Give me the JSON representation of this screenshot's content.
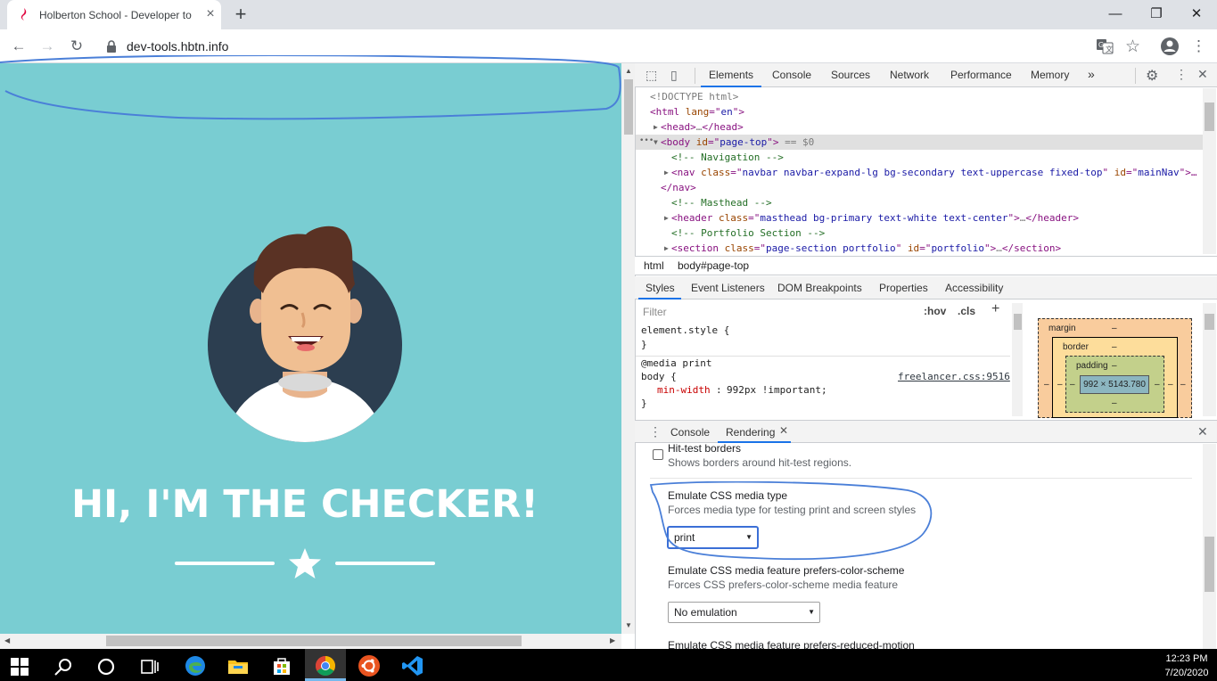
{
  "browser": {
    "tab_title": "Holberton School - Developer to",
    "url": "dev-tools.hbtn.info"
  },
  "page": {
    "hero_title": "HI, I'M THE CHECKER!"
  },
  "devtools": {
    "tabs": [
      "Elements",
      "Console",
      "Sources",
      "Network",
      "Performance",
      "Memory"
    ],
    "more_tabs": "»",
    "elements_lines": [
      {
        "parts": [
          {
            "c": "dim",
            "t": "<!DOCTYPE html>"
          }
        ]
      },
      {
        "parts": [
          {
            "c": "tag",
            "t": "<html "
          },
          {
            "c": "attr",
            "t": "lang"
          },
          {
            "c": "tag",
            "t": "=\""
          },
          {
            "c": "val",
            "t": "en"
          },
          {
            "c": "tag",
            "t": "\">"
          }
        ]
      },
      {
        "parts": [
          {
            "c": "tag",
            "t": "<head>"
          },
          {
            "c": "dim",
            "t": "…"
          },
          {
            "c": "tag",
            "t": "</head>"
          }
        ]
      },
      {
        "parts": [
          {
            "c": "tag",
            "t": "<body "
          },
          {
            "c": "attr",
            "t": "id"
          },
          {
            "c": "tag",
            "t": "=\""
          },
          {
            "c": "val",
            "t": "page-top"
          },
          {
            "c": "tag",
            "t": "\">"
          },
          {
            "c": "dim",
            "t": " == $0"
          }
        ]
      },
      {
        "parts": [
          {
            "c": "cmt",
            "t": "<!-- Navigation -->"
          }
        ]
      },
      {
        "parts": [
          {
            "c": "tag",
            "t": "<nav "
          },
          {
            "c": "attr",
            "t": "class"
          },
          {
            "c": "tag",
            "t": "=\""
          },
          {
            "c": "val",
            "t": "navbar navbar-expand-lg bg-secondary text-uppercase fixed-top"
          },
          {
            "c": "tag",
            "t": "\" "
          },
          {
            "c": "attr",
            "t": "id"
          },
          {
            "c": "tag",
            "t": "=\""
          },
          {
            "c": "val",
            "t": "mainNav"
          },
          {
            "c": "tag",
            "t": "\">…"
          }
        ]
      },
      {
        "parts": [
          {
            "c": "tag",
            "t": "</nav>"
          }
        ]
      },
      {
        "parts": [
          {
            "c": "cmt",
            "t": "<!-- Masthead -->"
          }
        ]
      },
      {
        "parts": [
          {
            "c": "tag",
            "t": "<header "
          },
          {
            "c": "attr",
            "t": "class"
          },
          {
            "c": "tag",
            "t": "=\""
          },
          {
            "c": "val",
            "t": "masthead bg-primary text-white text-center"
          },
          {
            "c": "tag",
            "t": "\">"
          },
          {
            "c": "dim",
            "t": "…"
          },
          {
            "c": "tag",
            "t": "</header>"
          }
        ]
      },
      {
        "parts": [
          {
            "c": "cmt",
            "t": "<!-- Portfolio Section -->"
          }
        ]
      },
      {
        "parts": [
          {
            "c": "tag",
            "t": "<section "
          },
          {
            "c": "attr",
            "t": "class"
          },
          {
            "c": "tag",
            "t": "=\""
          },
          {
            "c": "val",
            "t": "page-section portfolio"
          },
          {
            "c": "tag",
            "t": "\" "
          },
          {
            "c": "attr",
            "t": "id"
          },
          {
            "c": "tag",
            "t": "=\""
          },
          {
            "c": "val",
            "t": "portfolio"
          },
          {
            "c": "tag",
            "t": "\">"
          },
          {
            "c": "dim",
            "t": "…"
          },
          {
            "c": "tag",
            "t": "</section>"
          }
        ]
      }
    ],
    "breadcrumb": [
      "html",
      "body#page-top"
    ],
    "sub_tabs": [
      "Styles",
      "Event Listeners",
      "DOM Breakpoints",
      "Properties",
      "Accessibility"
    ],
    "filter_placeholder": "Filter",
    "hov": ":hov",
    "cls": ".cls",
    "plus": "+",
    "styles": {
      "element_style_open": "element.style {",
      "close_brace": "}",
      "media": "@media print",
      "selector": "body {",
      "property": "min-width",
      "value": "992px !important;",
      "source": "freelancer.css:9516"
    },
    "box_model": {
      "margin_label": "margin",
      "border_label": "border",
      "padding_label": "padding",
      "dash": "–",
      "content_size": "992 × 5143.780"
    },
    "drawer_tabs": [
      "Console",
      "Rendering"
    ],
    "rendering": {
      "hit_test_title": "Hit-test borders",
      "hit_test_desc": "Shows borders around hit-test regions.",
      "media_type_title": "Emulate CSS media type",
      "media_type_desc": "Forces media type for testing print and screen styles",
      "media_type_value": "print",
      "color_scheme_title": "Emulate CSS media feature prefers-color-scheme",
      "color_scheme_desc": "Forces CSS prefers-color-scheme media feature",
      "color_scheme_value": "No emulation",
      "reduced_motion_title": "Emulate CSS media feature prefers-reduced-motion"
    }
  },
  "taskbar": {
    "time": "12:23 PM",
    "date": "7/20/2020"
  },
  "colors": {
    "page_bg": "#79cdd2",
    "accent": "#1a73e8",
    "annotation": "#4a7fd8"
  }
}
